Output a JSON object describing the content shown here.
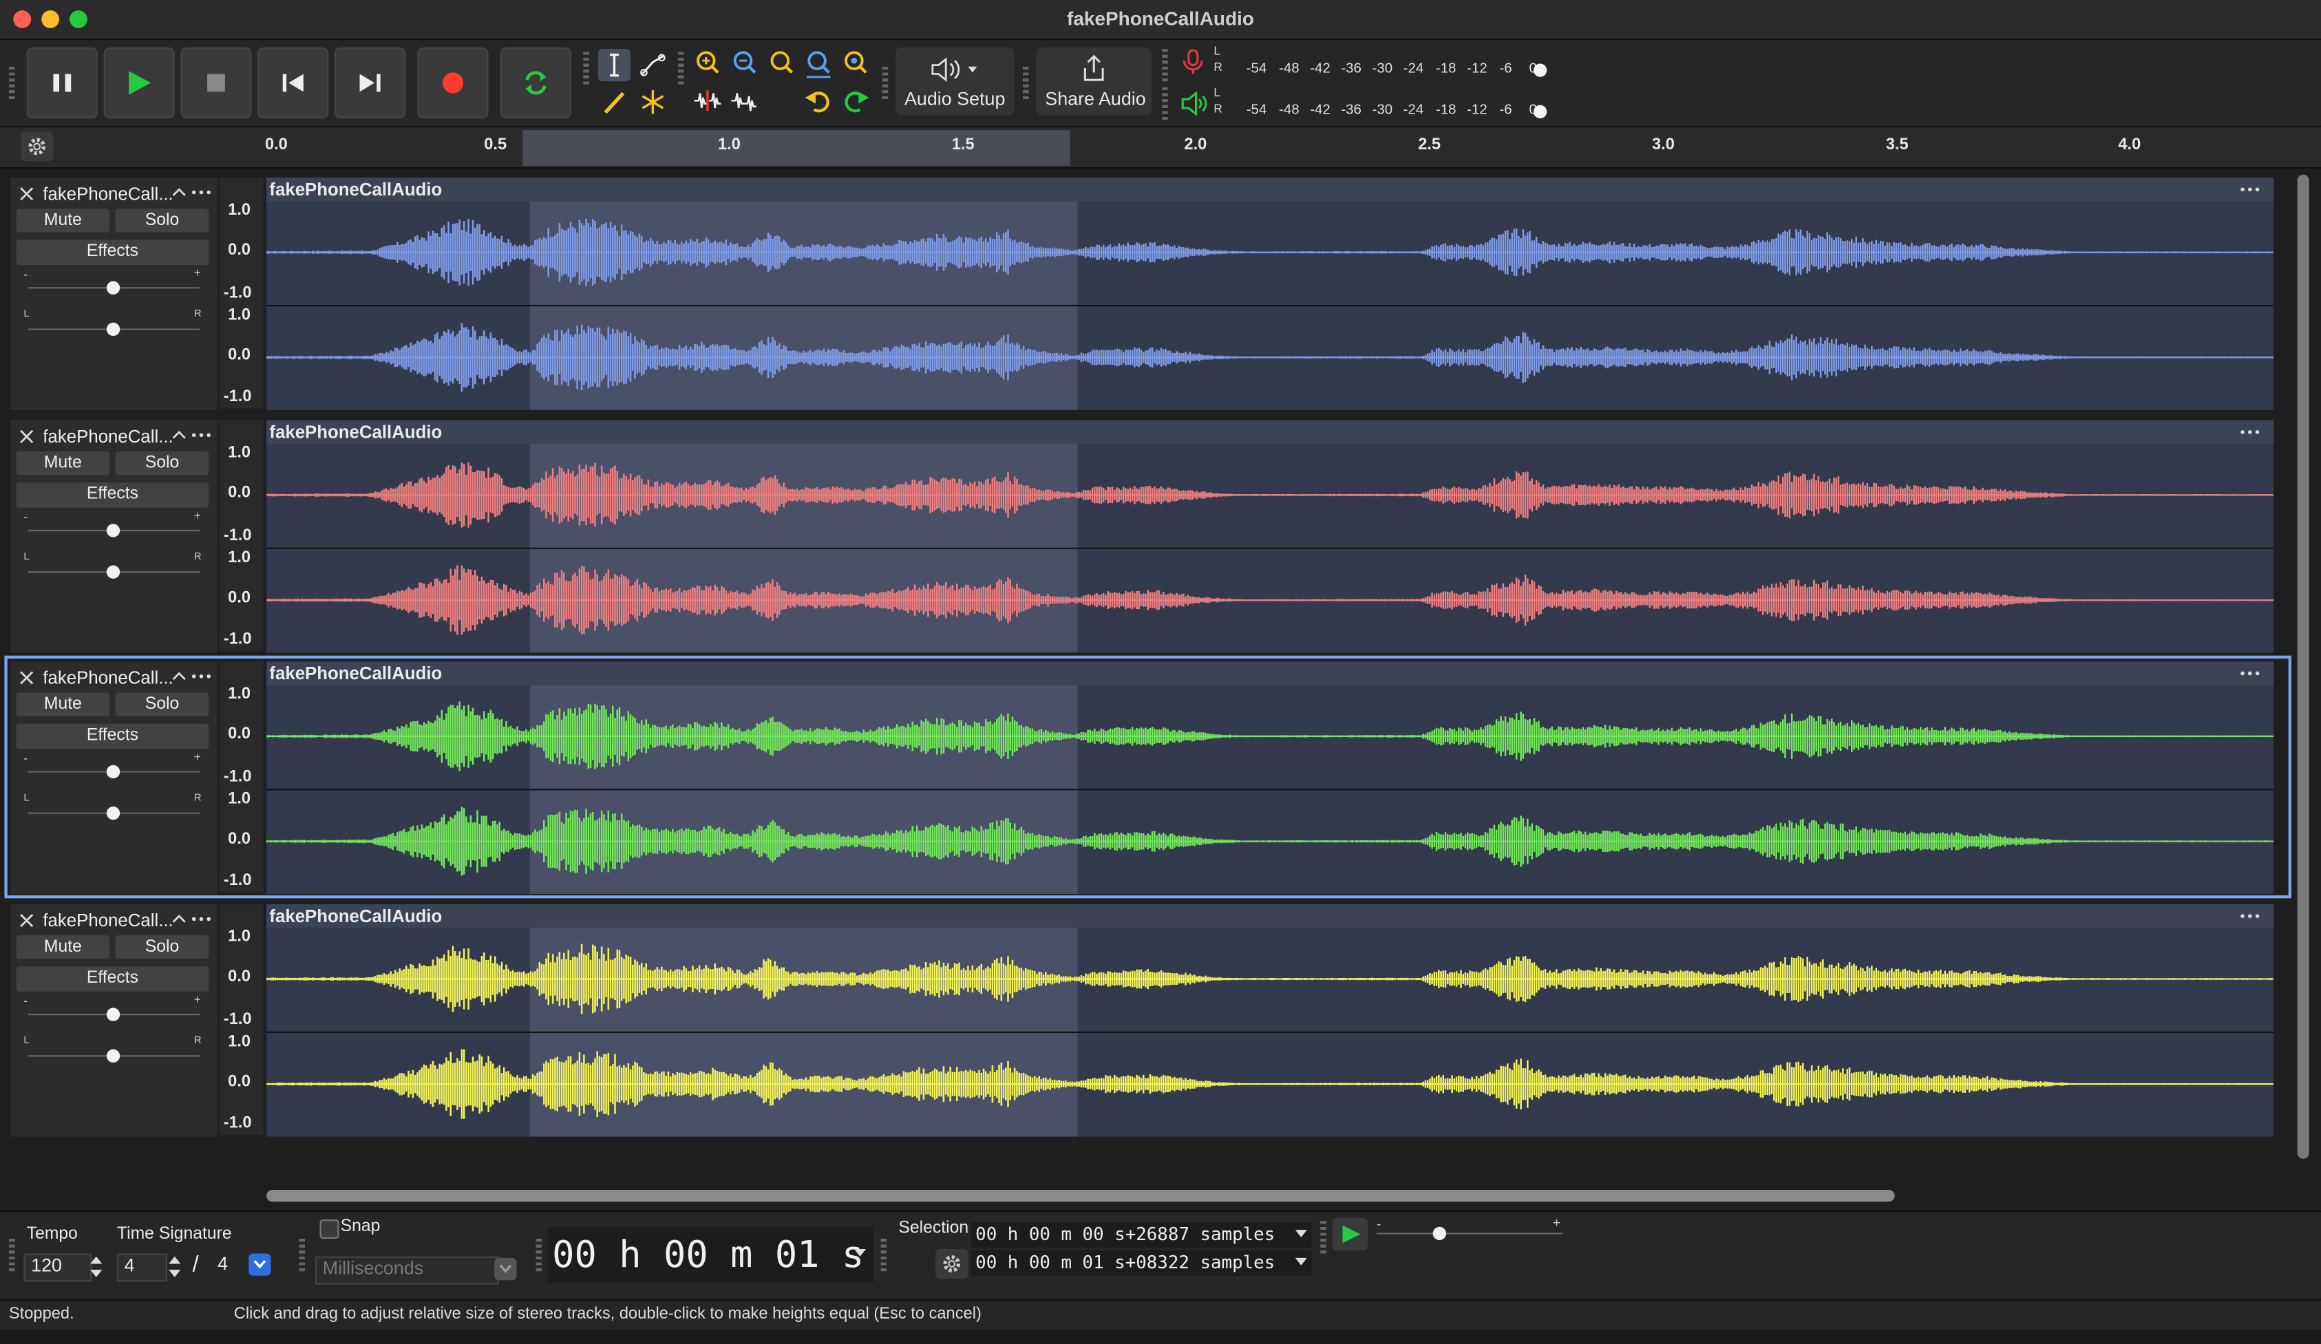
{
  "window": {
    "title": "fakePhoneCallAudio"
  },
  "toolbar": {
    "audio_setup_label": "Audio Setup",
    "share_audio_label": "Share Audio",
    "meter_scale": [
      "-54",
      "-48",
      "-42",
      "-36",
      "-30",
      "-24",
      "-18",
      "-12",
      "-6",
      "0"
    ],
    "meter_channels": [
      "L",
      "R"
    ]
  },
  "ruler": {
    "ticks": [
      "0.0",
      "0.5",
      "1.0",
      "1.5",
      "2.0",
      "2.5",
      "3.0",
      "3.5",
      "4.0"
    ]
  },
  "tracks": [
    {
      "name": "fakePhoneCall...",
      "clip_title": "fakePhoneCallAudio",
      "color": "#7f9be6",
      "selected": false
    },
    {
      "name": "fakePhoneCall...",
      "clip_title": "fakePhoneCallAudio",
      "color": "#ec7f7f",
      "selected": false
    },
    {
      "name": "fakePhoneCall...",
      "clip_title": "fakePhoneCallAudio",
      "color": "#73e65a",
      "selected": true
    },
    {
      "name": "fakePhoneCall...",
      "clip_title": "fakePhoneCallAudio",
      "color": "#f2f25a",
      "selected": false
    }
  ],
  "track_controls": {
    "mute": "Mute",
    "solo": "Solo",
    "effects": "Effects",
    "gain_min": "-",
    "gain_max": "+",
    "pan_left": "L",
    "pan_right": "R"
  },
  "axis_labels": [
    "1.0",
    "0.0",
    "-1.0"
  ],
  "bottom": {
    "tempo_label": "Tempo",
    "tempo_value": "120",
    "time_signature_label": "Time Signature",
    "ts_numerator": "4",
    "ts_separator": "/",
    "ts_denominator": "4",
    "snap_label": "Snap",
    "snap_unit": "Milliseconds",
    "time_display": "00 h 00 m 01 s",
    "selection_label": "Selection",
    "selection_start": "00 h 00 m 00 s+26887 samples",
    "selection_end": "00 h 00 m 01 s+08322 samples",
    "speed_min": "-",
    "speed_max": "+"
  },
  "status": {
    "state": "Stopped.",
    "hint": "Click and drag to adjust relative size of stereo tracks, double-click to make heights equal (Esc to cancel)"
  }
}
